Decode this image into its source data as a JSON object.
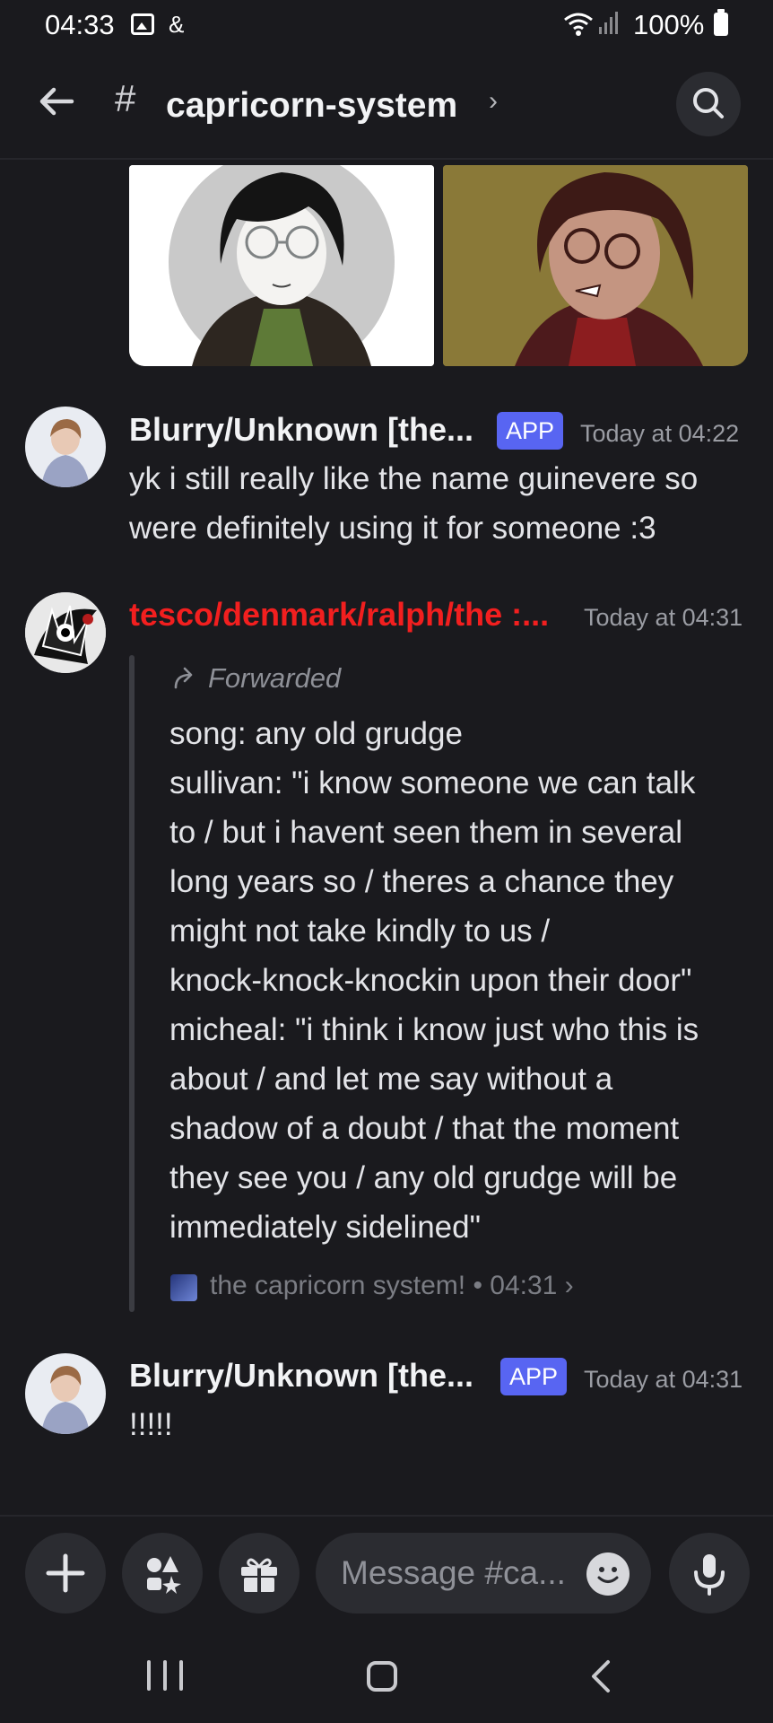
{
  "status_bar": {
    "time": "04:33",
    "extra": "&",
    "battery": "100%"
  },
  "header": {
    "hash": "#",
    "channel_name": "capricorn-system",
    "chevron": "›"
  },
  "messages": [
    {
      "username": "Blurry/Unknown [the...",
      "badge": "APP",
      "timestamp": "Today at 04:22",
      "text": "yk i still really like the name guinevere so were definitely using it for someone :3"
    },
    {
      "username": "tesco/denmark/ralph/the :...",
      "username_color": "#f21f1f",
      "timestamp": "Today at 04:31",
      "forward": {
        "label": "Forwarded",
        "lines": [
          "song: any old grudge",
          "sullivan: \"i know someone we can talk",
          "to / but i havent seen them in several",
          "long years so / theres a chance they",
          "might not take kindly to us /",
          "knock-knock-knockin upon their door\"",
          "micheal: \"i think i know just who this is",
          "about / and let me say without a",
          "shadow of a doubt / that the moment",
          "they see you / any old grudge will be",
          "immediately sidelined\""
        ],
        "source": "the capricorn system! • 04:31 ›"
      }
    },
    {
      "username": "Blurry/Unknown [the...",
      "badge": "APP",
      "timestamp": "Today at 04:31",
      "text": "!!!!!"
    }
  ],
  "input": {
    "placeholder": "Message #ca..."
  },
  "colors": {
    "background": "#1a1a1e",
    "app_badge": "#5865f2",
    "red_username": "#f21f1f"
  }
}
